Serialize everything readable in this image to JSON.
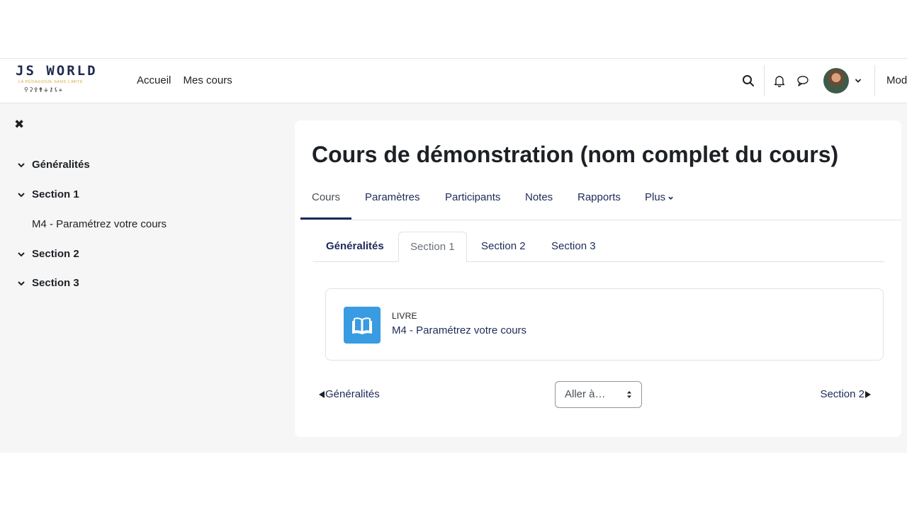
{
  "brand": {
    "logo_text": "JS WORLD",
    "logo_tagline": "LA PÉDAGOGIE SANS LIMITE"
  },
  "navbar": {
    "links": [
      "Accueil",
      "Mes cours"
    ],
    "icons": [
      "search-icon",
      "bell-icon",
      "chat-icon",
      "avatar",
      "chevron-down-icon"
    ],
    "mode_text": "Mod"
  },
  "drawer": {
    "close_icon": "close-icon",
    "items": [
      {
        "label": "Généralités"
      },
      {
        "label": "Section 1"
      },
      {
        "label": "M4 - Paramétrez votre cours"
      },
      {
        "label": "Section 2"
      },
      {
        "label": "Section 3"
      }
    ]
  },
  "course": {
    "title": "Cours de démonstration (nom complet du cours)",
    "secondary_nav": [
      "Cours",
      "Paramètres",
      "Participants",
      "Notes",
      "Rapports",
      "Plus"
    ],
    "active_secondary": "Cours"
  },
  "topics": {
    "tabs": [
      "Généralités",
      "Section 1",
      "Section 2",
      "Section 3"
    ],
    "active": "Section 1"
  },
  "activity": {
    "type": "LIVRE",
    "name": "M4 - Paramétrez votre cours",
    "icon": "book-icon",
    "icon_color": "#399be2"
  },
  "footer_nav": {
    "prev_label": "Généralités",
    "jump_label": "Aller à…",
    "next_label": "Section 2"
  },
  "colors": {
    "link": "#1d2b58",
    "text": "#1d2125",
    "page_bg": "#f6f6f6"
  }
}
